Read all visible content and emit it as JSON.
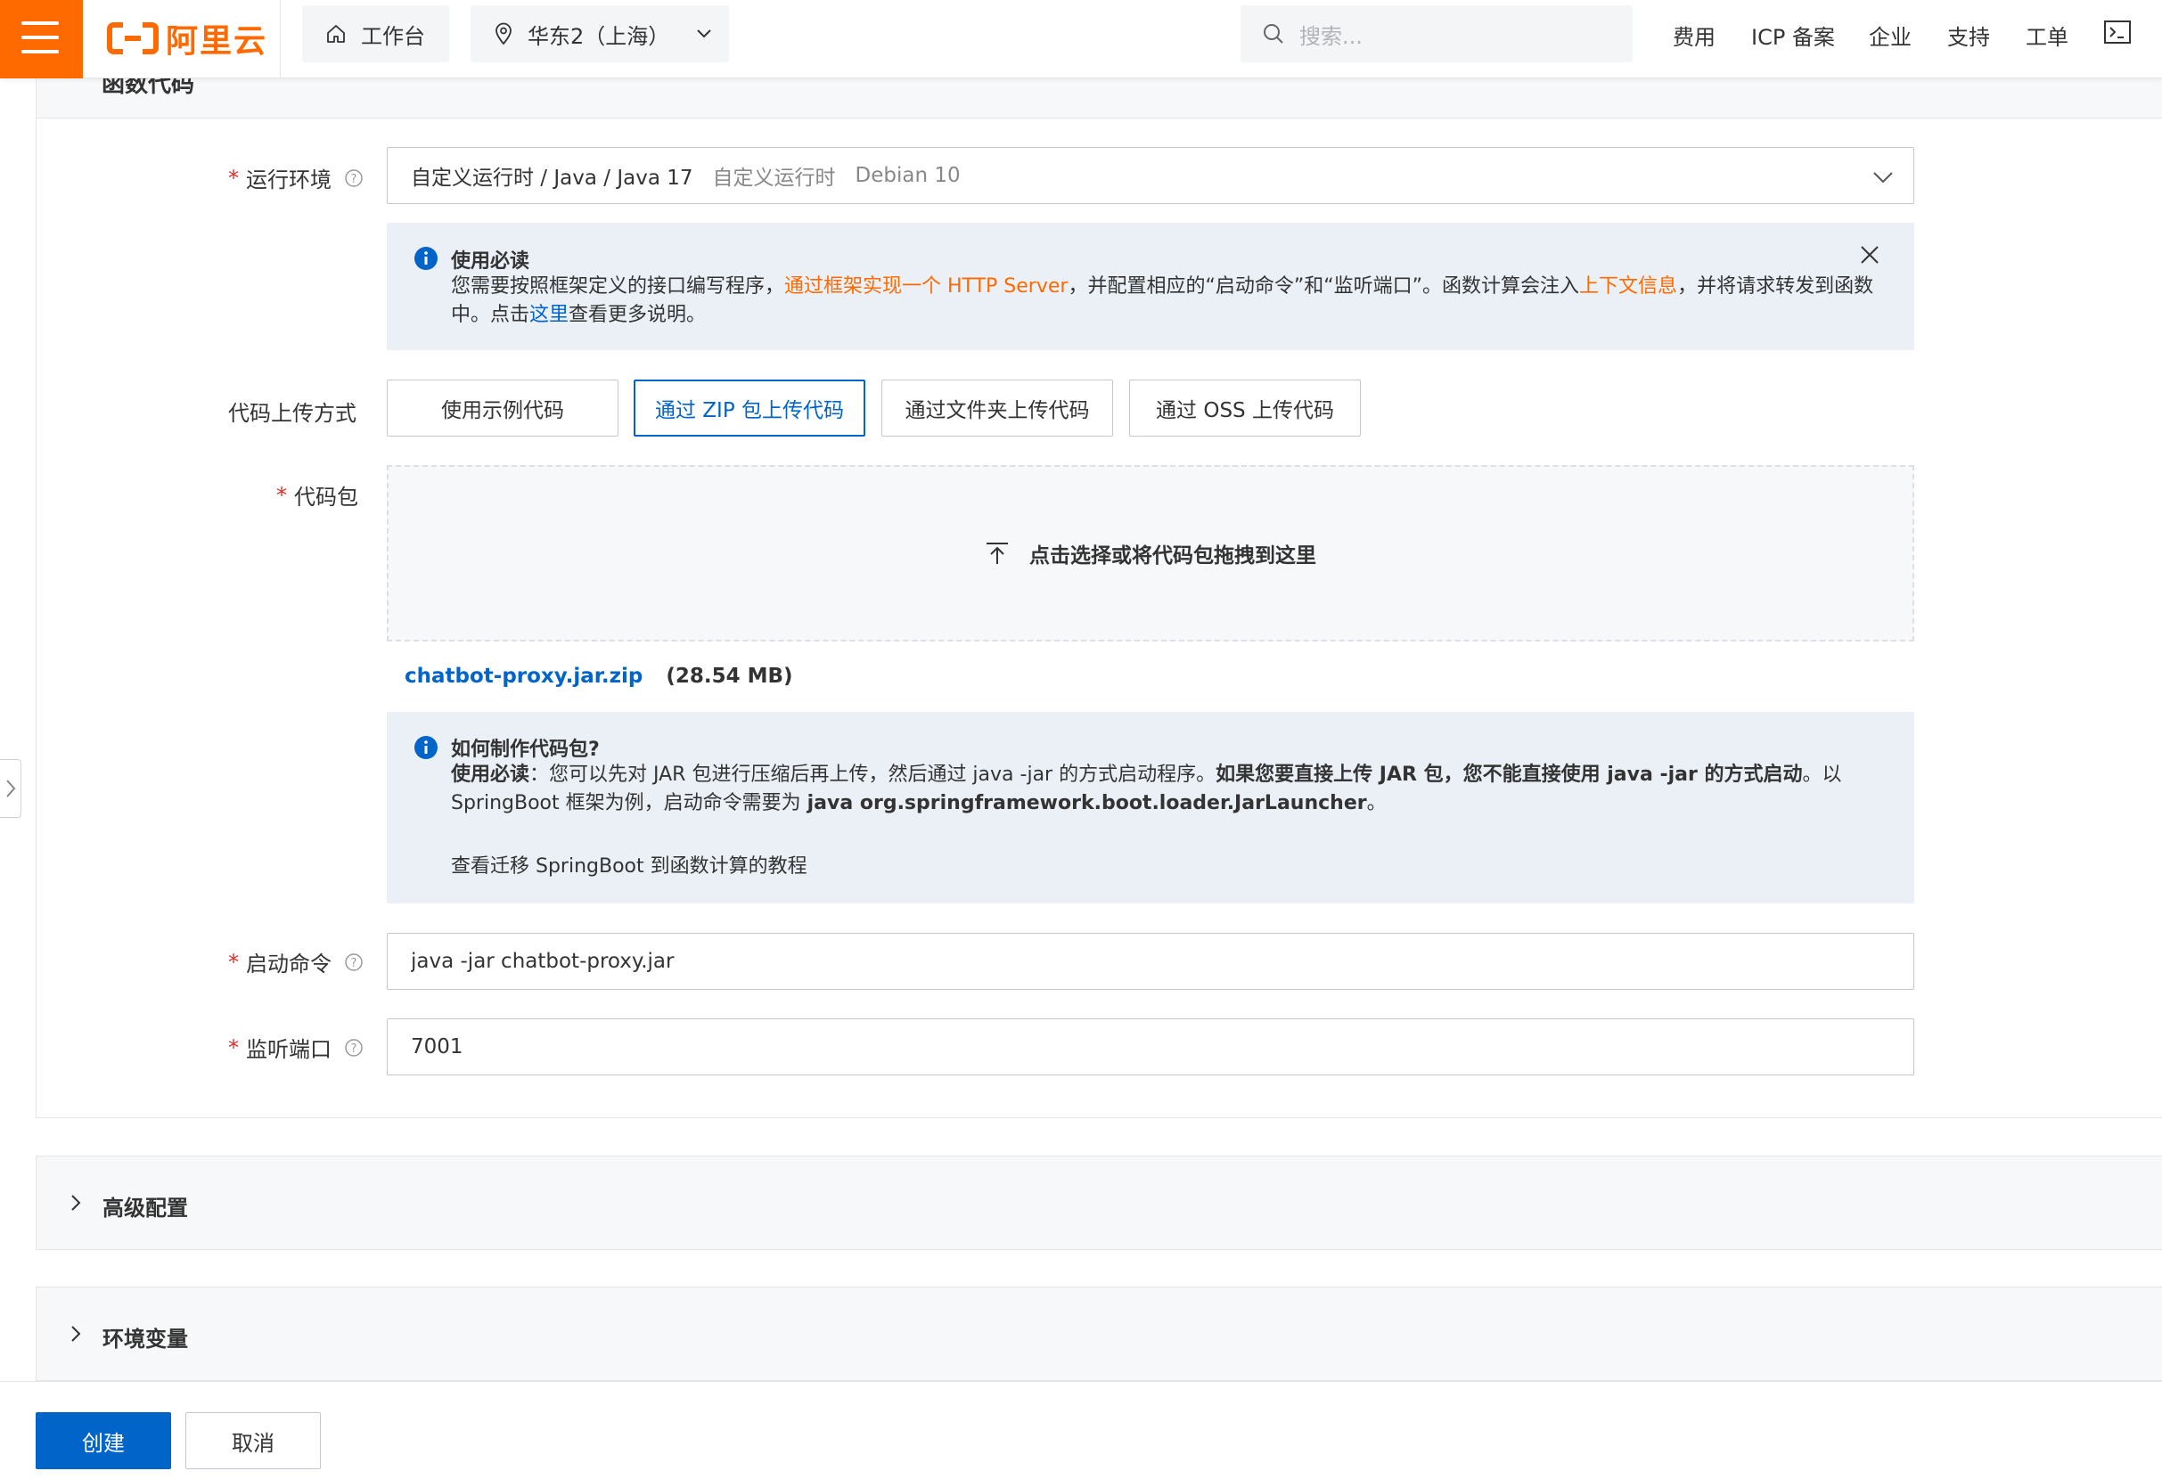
{
  "header": {
    "brand": "阿里云",
    "workbench": "工作台",
    "region": "华东2（上海）",
    "search_placeholder": "搜索...",
    "nav": [
      "费用",
      "ICP 备案",
      "企业",
      "支持",
      "工单"
    ],
    "brand_color": "#ff6a00"
  },
  "section_title": "函数代码",
  "form": {
    "runtime": {
      "label": "运行环境",
      "value": "自定义运行时 / Java /  Java 17",
      "sub1": "自定义运行时",
      "sub2": "Debian 10"
    },
    "notice1": {
      "title": "使用必读",
      "p1": "您需要按照框架定义的接口编写程序，",
      "link1": "通过框架实现一个 HTTP Server",
      "p2": "，并配置相应的“启动命令”和“监听端口”。函数计算会注入",
      "link2": "上下文信息",
      "p3": "，并将请求转发到函数中。点击",
      "link3": "这里",
      "p4": "查看更多说明。"
    },
    "upload_method": {
      "label": "代码上传方式",
      "options": [
        "使用示例代码",
        "通过 ZIP 包上传代码",
        "通过文件夹上传代码",
        "通过 OSS 上传代码"
      ],
      "selected": "通过 ZIP 包上传代码"
    },
    "code_package": {
      "label": "代码包",
      "dropzone_text": "点击选择或将代码包拖拽到这里",
      "file_name": "chatbot-proxy.jar.zip",
      "file_size": "(28.54 MB)"
    },
    "notice2": {
      "title": "如何制作代码包?",
      "lead": "使用必读",
      "p1": "：您可以先对 JAR 包进行压缩后再上传，然后通过 java -jar 的方式启动程序。",
      "bold1": "如果您要直接上传 JAR 包，您不能直接使用 java -jar 的方式启动",
      "p2": "。以 SpringBoot 框架为例，启动命令需要为 ",
      "bold2": "java org.springframework.boot.loader.JarLauncher",
      "p3": "。",
      "link": "查看迁移 SpringBoot 到函数计算的教程"
    },
    "start_command": {
      "label": "启动命令",
      "value": "java -jar chatbot-proxy.jar"
    },
    "listen_port": {
      "label": "监听端口",
      "value": "7001"
    }
  },
  "sections": {
    "advanced": "高级配置",
    "env": "环境变量"
  },
  "footer": {
    "create": "创建",
    "cancel": "取消"
  },
  "colors": {
    "primary": "#0064c8",
    "link_orange": "#ff6a00",
    "required": "#d93026"
  }
}
